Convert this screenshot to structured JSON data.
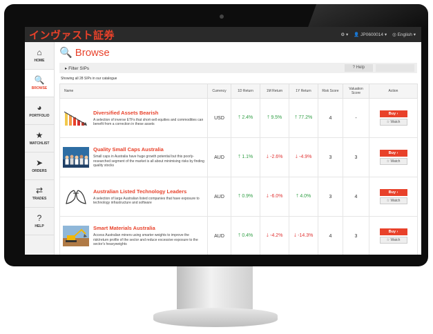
{
  "app": {
    "brand": "インヴァスト証券",
    "user_menu": "JP0600014",
    "language": "English"
  },
  "sidebar": {
    "items": [
      {
        "label": "HOME",
        "icon": "home-icon"
      },
      {
        "label": "BROWSE",
        "icon": "search-icon"
      },
      {
        "label": "PORTFOLIO",
        "icon": "pie-chart-icon"
      },
      {
        "label": "WATCHLIST",
        "icon": "star-icon"
      },
      {
        "label": "ORDERS",
        "icon": "paper-plane-icon"
      },
      {
        "label": "TRADES",
        "icon": "exchange-icon"
      },
      {
        "label": "HELP",
        "icon": "question-icon"
      }
    ]
  },
  "main": {
    "title": "Browse",
    "filter_label": "Filter SIPs",
    "help_label": "Help",
    "showing_text": "Showing all 28 SIPs in our catalogue"
  },
  "table": {
    "headers": {
      "name": "Name",
      "currency": "Currency",
      "r1d": "1D Return",
      "r1m": "1M Return",
      "r1y": "1Y Return",
      "risk": "Risk Score",
      "valuation": "Valuation Score",
      "action": "Action"
    },
    "buy_label": "Buy",
    "watch_label": "Watch",
    "rows": [
      {
        "name": "Diversified Assets Bearish",
        "desc": "A selection of inverse ETFs that short-sell equities and commodities can benefit from a correction in these assets",
        "currency": "USD",
        "r1d": "2.4%",
        "r1m": "9.5%",
        "r1y": "77.2%",
        "r1d_dir": "up",
        "r1m_dir": "up",
        "r1y_dir": "up",
        "risk": "4",
        "valuation": "-"
      },
      {
        "name": "Quality Small Caps Australia",
        "desc": "Small caps in Australia have huge growth potential but this poorly-researched segment of the market is all about minimising risks by finding quality stocks",
        "currency": "AUD",
        "r1d": "1.1%",
        "r1m": "-2.6%",
        "r1y": "-4.9%",
        "r1d_dir": "up",
        "r1m_dir": "down",
        "r1y_dir": "down",
        "risk": "3",
        "valuation": "3"
      },
      {
        "name": "Australian Listed Technology Leaders",
        "desc": "A selection of large Australian listed companies that have exposure to technology infrastructure and software",
        "currency": "AUD",
        "r1d": "0.9%",
        "r1m": "-6.0%",
        "r1y": "4.0%",
        "r1d_dir": "up",
        "r1m_dir": "down",
        "r1y_dir": "up",
        "risk": "3",
        "valuation": "4"
      },
      {
        "name": "Smart Materials Australia",
        "desc": "Access Australian miners using smarter weights to improve the risk/return profile of the sector and reduce excessive exposure to the sector's heavyweights",
        "currency": "AUD",
        "r1d": "0.4%",
        "r1m": "-4.2%",
        "r1y": "-14.3%",
        "r1d_dir": "up",
        "r1m_dir": "down",
        "r1y_dir": "down",
        "risk": "4",
        "valuation": "3"
      }
    ]
  },
  "colors": {
    "brand": "#e8412a",
    "positive": "#2f9e44",
    "negative": "#e03131"
  }
}
